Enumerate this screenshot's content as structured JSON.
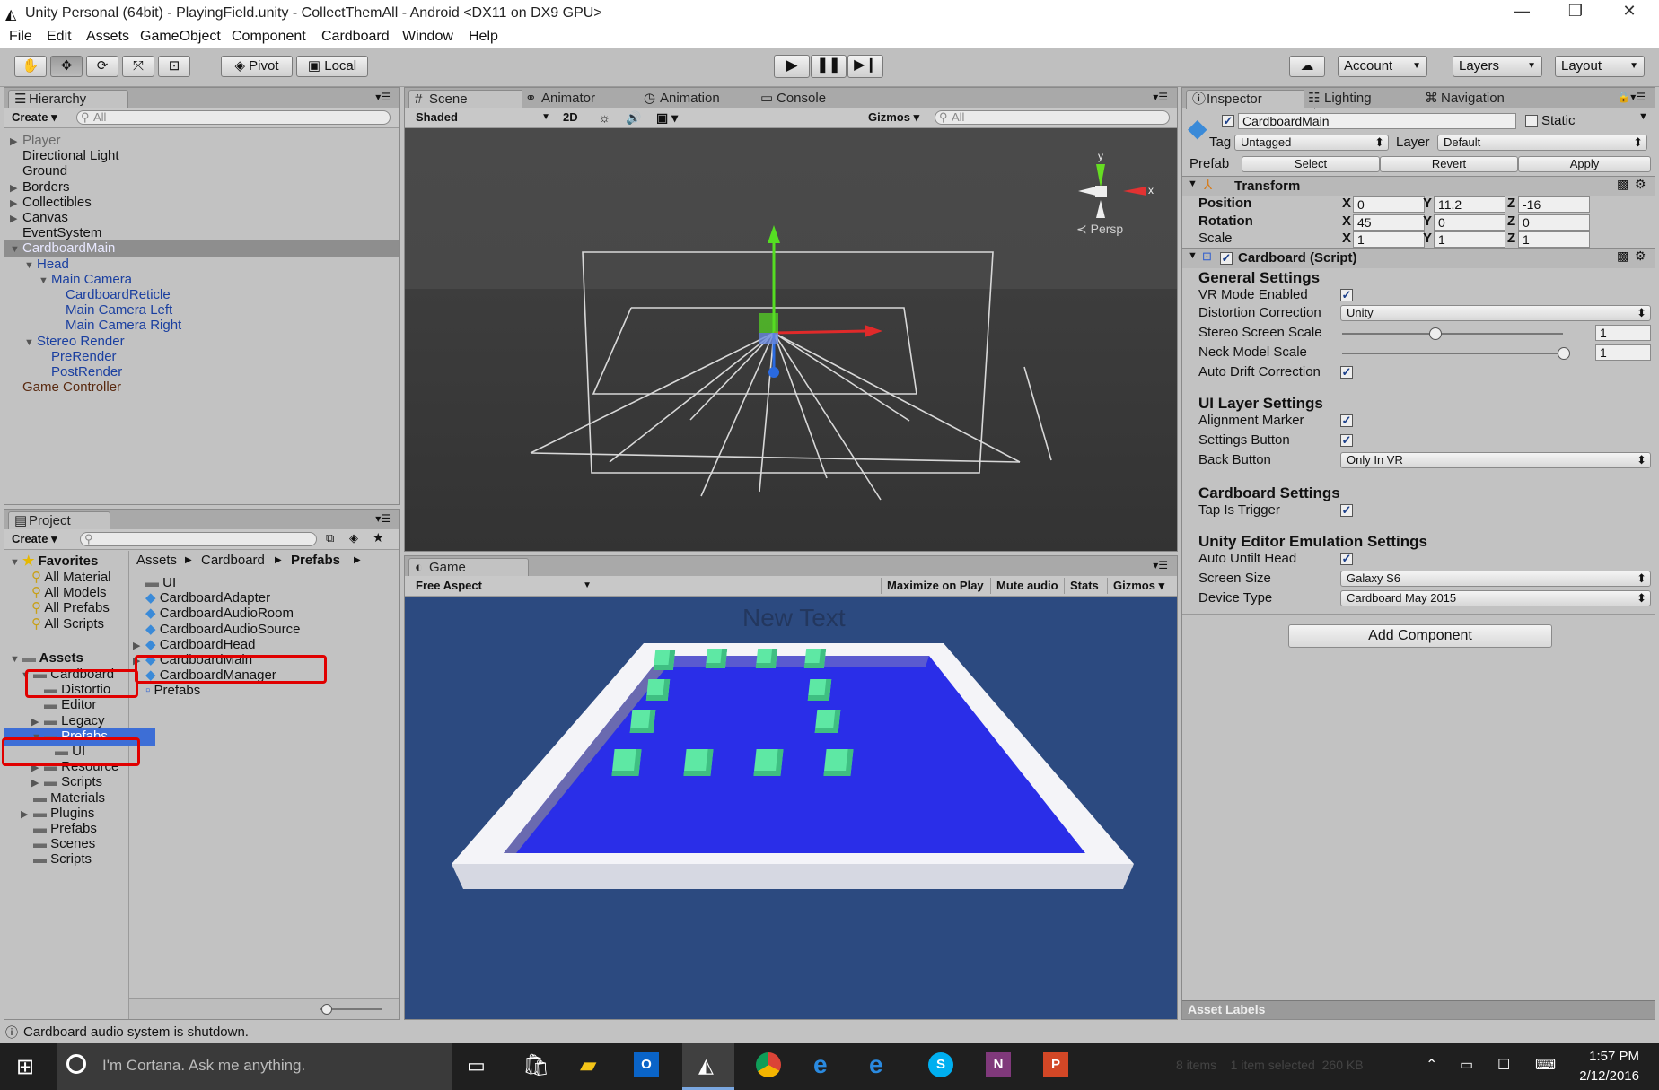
{
  "window": {
    "title": "Unity Personal (64bit) - PlayingField.unity - CollectThemAll - Android <DX11 on DX9 GPU>"
  },
  "menu": [
    "File",
    "Edit",
    "Assets",
    "GameObject",
    "Component",
    "Cardboard",
    "Window",
    "Help"
  ],
  "toolbar": {
    "pivot": "Pivot",
    "local": "Local",
    "account": "Account",
    "layers": "Layers",
    "layout": "Layout"
  },
  "hierarchy": {
    "tab": "Hierarchy",
    "create": "Create",
    "search_placeholder": "All",
    "items": [
      {
        "label": "Player",
        "arrow": "▶",
        "indent": 0,
        "style": "grey"
      },
      {
        "label": "Directional Light",
        "arrow": "",
        "indent": 0,
        "style": "normal"
      },
      {
        "label": "Ground",
        "arrow": "",
        "indent": 0,
        "style": "normal"
      },
      {
        "label": "Borders",
        "arrow": "▶",
        "indent": 0,
        "style": "normal"
      },
      {
        "label": "Collectibles",
        "arrow": "▶",
        "indent": 0,
        "style": "normal"
      },
      {
        "label": "Canvas",
        "arrow": "▶",
        "indent": 0,
        "style": "normal"
      },
      {
        "label": "EventSystem",
        "arrow": "",
        "indent": 0,
        "style": "normal"
      },
      {
        "label": "CardboardMain",
        "arrow": "▼",
        "indent": 0,
        "style": "selected"
      },
      {
        "label": "Head",
        "arrow": "▼",
        "indent": 1,
        "style": "blue"
      },
      {
        "label": "Main Camera",
        "arrow": "▼",
        "indent": 2,
        "style": "blue"
      },
      {
        "label": "CardboardReticle",
        "arrow": "",
        "indent": 3,
        "style": "blue"
      },
      {
        "label": "Main Camera Left",
        "arrow": "",
        "indent": 3,
        "style": "blue"
      },
      {
        "label": "Main Camera Right",
        "arrow": "",
        "indent": 3,
        "style": "blue"
      },
      {
        "label": "Stereo Render",
        "arrow": "▼",
        "indent": 1,
        "style": "blue"
      },
      {
        "label": "PreRender",
        "arrow": "",
        "indent": 2,
        "style": "blue"
      },
      {
        "label": "PostRender",
        "arrow": "",
        "indent": 2,
        "style": "blue"
      },
      {
        "label": "Game Controller",
        "arrow": "",
        "indent": 0,
        "style": "brown"
      }
    ]
  },
  "scene": {
    "tabs": [
      "Scene",
      "Animator",
      "Animation",
      "Console"
    ],
    "shaded": "Shaded",
    "mode2d": "2D",
    "gizmos": "Gizmos",
    "search_placeholder": "All",
    "persp": "Persp",
    "axis_x": "x",
    "axis_y": "y"
  },
  "game": {
    "tab": "Game",
    "aspect": "Free Aspect",
    "maximize": "Maximize on Play",
    "mute": "Mute audio",
    "stats": "Stats",
    "gizmos": "Gizmos",
    "new_text": "New Text"
  },
  "project": {
    "tab": "Project",
    "create": "Create",
    "favorites_label": "Favorites",
    "favorites": [
      "All Material",
      "All Models",
      "All Prefabs",
      "All Scripts"
    ],
    "assets_label": "Assets",
    "tree": [
      {
        "label": "Cardboard",
        "indent": 1,
        "arrow": "▼"
      },
      {
        "label": "Distortio",
        "indent": 2,
        "arrow": ""
      },
      {
        "label": "Editor",
        "indent": 2,
        "arrow": ""
      },
      {
        "label": "Legacy",
        "indent": 2,
        "arrow": "▶"
      },
      {
        "label": "Prefabs",
        "indent": 2,
        "arrow": "▼"
      },
      {
        "label": "UI",
        "indent": 3,
        "arrow": ""
      },
      {
        "label": "Resource",
        "indent": 2,
        "arrow": "▶"
      },
      {
        "label": "Scripts",
        "indent": 2,
        "arrow": "▶"
      },
      {
        "label": "Materials",
        "indent": 1,
        "arrow": ""
      },
      {
        "label": "Plugins",
        "indent": 1,
        "arrow": "▶"
      },
      {
        "label": "Prefabs",
        "indent": 1,
        "arrow": ""
      },
      {
        "label": "Scenes",
        "indent": 1,
        "arrow": ""
      },
      {
        "label": "Scripts",
        "indent": 1,
        "arrow": ""
      }
    ],
    "breadcrumb": [
      "Assets",
      "Cardboard",
      "Prefabs"
    ],
    "files": [
      {
        "label": "UI",
        "type": "folder",
        "arrow": ""
      },
      {
        "label": "CardboardAdapter",
        "type": "prefab",
        "arrow": ""
      },
      {
        "label": "CardboardAudioRoom",
        "type": "prefab",
        "arrow": ""
      },
      {
        "label": "CardboardAudioSource",
        "type": "prefab",
        "arrow": ""
      },
      {
        "label": "CardboardHead",
        "type": "prefab",
        "arrow": "▶"
      },
      {
        "label": "CardboardMain",
        "type": "prefab",
        "arrow": "▶"
      },
      {
        "label": "CardboardManager",
        "type": "prefab",
        "arrow": ""
      },
      {
        "label": "Prefabs",
        "type": "script",
        "arrow": ""
      }
    ]
  },
  "inspector": {
    "tabs": [
      "Inspector",
      "Lighting",
      "Navigation"
    ],
    "object_name": "CardboardMain",
    "static_label": "Static",
    "tag_label": "Tag",
    "tag_value": "Untagged",
    "layer_label": "Layer",
    "layer_value": "Default",
    "prefab_label": "Prefab",
    "prefab_buttons": [
      "Select",
      "Revert",
      "Apply"
    ],
    "transform": {
      "title": "Transform",
      "rows": [
        {
          "label": "Position",
          "x": "0",
          "y": "11.2",
          "z": "-16"
        },
        {
          "label": "Rotation",
          "x": "45",
          "y": "0",
          "z": "0"
        },
        {
          "label": "Scale",
          "x": "1",
          "y": "1",
          "z": "1"
        }
      ]
    },
    "script": {
      "title": "Cardboard (Script)",
      "general": "General Settings",
      "vr_mode": "VR Mode Enabled",
      "distortion": "Distortion Correction",
      "distortion_value": "Unity",
      "stereo": "Stereo Screen Scale",
      "stereo_value": "1",
      "stereo_slider": 0.42,
      "neck": "Neck Model Scale",
      "neck_value": "1",
      "neck_slider": 1.0,
      "drift": "Auto Drift Correction",
      "ui_layer": "UI Layer Settings",
      "alignment": "Alignment Marker",
      "settings_btn": "Settings Button",
      "back": "Back Button",
      "back_value": "Only In VR",
      "cardboard": "Cardboard Settings",
      "tap": "Tap Is Trigger",
      "editor": "Unity Editor Emulation Settings",
      "untilt": "Auto Untilt Head",
      "screen": "Screen Size",
      "screen_value": "Galaxy S6",
      "device": "Device Type",
      "device_value": "Cardboard May 2015"
    },
    "add_component": "Add Component",
    "asset_labels": "Asset Labels"
  },
  "status": {
    "message": "Cardboard audio system is shutdown."
  },
  "taskbar": {
    "cortana": "I'm Cortana. Ask me anything.",
    "time": "1:57 PM",
    "date": "2/12/2016",
    "ghost": "8 items    1 item selected  260 KB"
  },
  "colors": {
    "selection": "#3d6ed6",
    "red_highlight": "#e00000",
    "game_bg": "#2c4a80",
    "floor": "#2a2ee8",
    "cube": "#5ee8a4"
  }
}
